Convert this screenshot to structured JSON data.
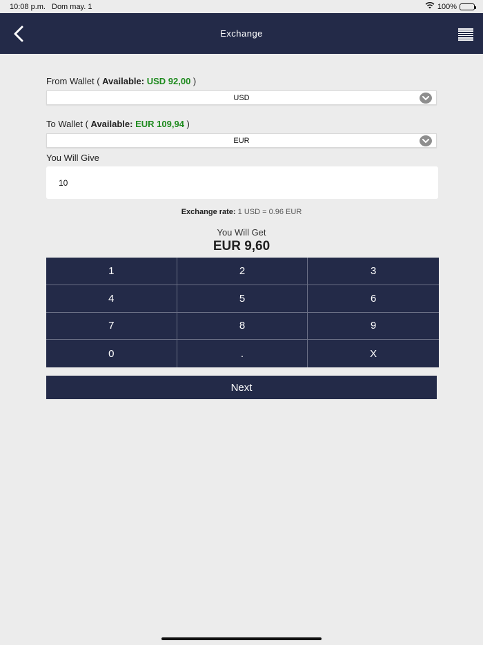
{
  "status_bar": {
    "time": "10:08 p.m.",
    "date": "Dom may. 1",
    "battery": "100%",
    "icons": [
      "wifi-icon",
      "battery-icon"
    ]
  },
  "navbar": {
    "title": "Exchange",
    "back_icon": "chevron-left-icon",
    "menu_icon": "hamburger-menu-icon"
  },
  "from_wallet": {
    "label": "From Wallet",
    "available_label": "Available:",
    "available_value": "USD 92,00",
    "selected": "USD"
  },
  "to_wallet": {
    "label": "To Wallet",
    "available_label": "Available:",
    "available_value": "EUR 109,94",
    "selected": "EUR"
  },
  "give": {
    "label": "You Will Give",
    "value": "10"
  },
  "rate": {
    "label": "Exchange rate:",
    "value": "1 USD = 0.96 EUR"
  },
  "get": {
    "label": "You Will Get",
    "value": "EUR 9,60"
  },
  "keypad": {
    "keys": [
      "1",
      "2",
      "3",
      "4",
      "5",
      "6",
      "7",
      "8",
      "9",
      "0",
      ".",
      "X"
    ]
  },
  "next_label": "Next",
  "colors": {
    "primary": "#232a48",
    "available": "#1e8a1e",
    "background": "#ececec"
  }
}
